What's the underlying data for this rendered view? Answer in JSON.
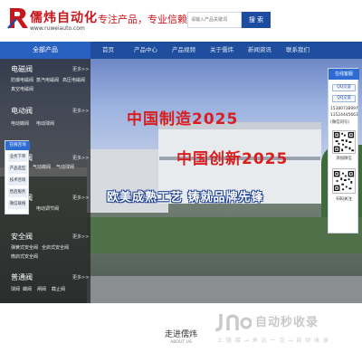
{
  "header": {
    "logo_name": "儒炜自动化",
    "logo_url": "www.ruweiauto.com",
    "slogan": "专注产品，专业信赖!",
    "search_placeholder": "请输入产品关键词",
    "search_button": "搜 索"
  },
  "nav": {
    "all_products": "全部产品",
    "items": [
      "首页",
      "产品中心",
      "产品视频",
      "关于儒炜",
      "新闻资讯",
      "联系我们"
    ]
  },
  "hero": {
    "title1": "中国制造2025",
    "title2": "中国创新2025",
    "tagline": "欧美成熟工艺 铸就品牌先锋"
  },
  "categories": [
    {
      "title": "电磁阀",
      "more": "更多>>",
      "subs": [
        "防爆电磁阀",
        "蒸汽电磁阀",
        "高压电磁阀",
        "真空电磁阀"
      ]
    },
    {
      "title": "电动阀",
      "more": "更多>>",
      "subs": [
        "电动蝶阀",
        "电动球阀"
      ]
    },
    {
      "title": "气动阀",
      "more": "更多>>",
      "subs": [
        "气动蝶阀",
        "气动球阀"
      ]
    },
    {
      "title": "调节阀",
      "more": "更多>>",
      "subs": [
        "电动调节阀"
      ]
    },
    {
      "title": "安全阀",
      "more": "更多>>",
      "subs": [
        "弹簧式安全阀",
        "全启式安全阀",
        "微启式安全阀"
      ]
    },
    {
      "title": "普通阀",
      "more": "更多>>",
      "subs": [
        "球阀",
        "蝶阀",
        "闸阀",
        "截止阀"
      ]
    }
  ],
  "service_left": {
    "head": "在线咨询",
    "items": [
      "业务下单",
      "产品选型",
      "技术咨询",
      "售后服务",
      "微信联络"
    ]
  },
  "service_right": {
    "head": "在线客服",
    "qq": [
      "QQ交谈",
      "QQ交谈"
    ],
    "phones": [
      "15380738997",
      "13524445663",
      "(微信同号)"
    ],
    "qr_labels": [
      "添加微信",
      "扫码关注"
    ]
  },
  "about": {
    "title": "走进儒炜",
    "subtitle": "ABOUT US"
  },
  "watermark": {
    "name": "自动秒收录",
    "tag": "上 链 接 → 来 访 一 次 → 自 动 收 录"
  },
  "colors": {
    "brand_red": "#c8161d",
    "nav_blue": "#1e4e9d",
    "accent_blue": "#2e6bd3"
  }
}
